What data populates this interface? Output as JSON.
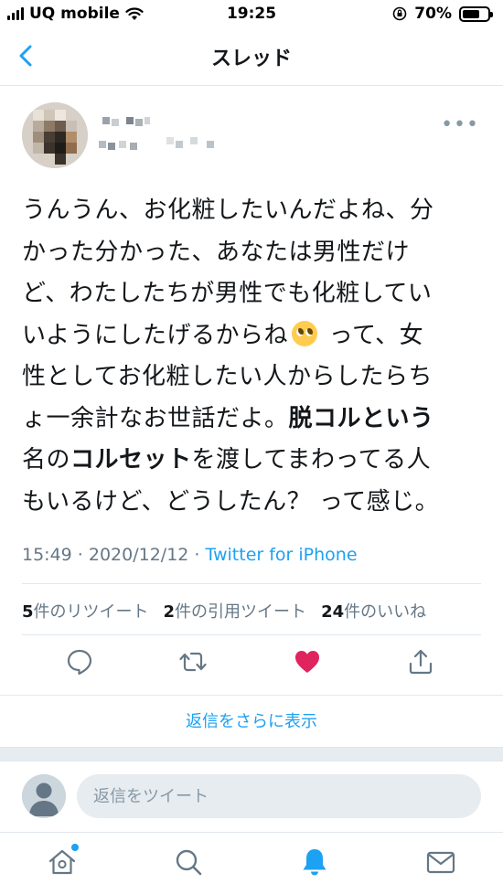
{
  "status_bar": {
    "carrier": "UQ mobile",
    "time": "19:25",
    "battery_percent": "70%",
    "battery_level": 0.7
  },
  "nav": {
    "title": "スレッド"
  },
  "tweet": {
    "text_lines": [
      "うんうん、お化粧したいんだよね、分",
      "かった分かった、あなたは男性だけ",
      "ど、わたしたちが男性でも化粧してい",
      "いようにしたげるからね",
      " って、女",
      "性としてお化粧したい人からしたらち",
      "ょ一余計なお世話だよ。",
      "脱コルという",
      "名の",
      "コルセット",
      "を渡してまわってる人",
      "もいるけど、どうしたん？ って感じ。"
    ],
    "timestamp": "15:49 · 2020/12/12 · ",
    "source": "Twitter for iPhone",
    "retweets_count": "5",
    "retweets_label": "件のリツイート",
    "quotes_count": "2",
    "quotes_label": "件の引用ツイート",
    "likes_count": "24",
    "likes_label": "件のいいね"
  },
  "show_more": {
    "label": "返信をさらに表示"
  },
  "composer": {
    "placeholder": "返信をツイート"
  },
  "colors": {
    "accent": "#1da1f2",
    "like": "#e0245e",
    "muted": "#657786"
  },
  "icons": {
    "back": "chevron-left-icon",
    "reply": "comment-icon",
    "retweet": "retweet-icon",
    "like": "heart-filled-icon",
    "share": "share-icon",
    "home": "home-icon",
    "search": "search-icon",
    "notifications": "bell-icon",
    "messages": "mail-icon"
  }
}
